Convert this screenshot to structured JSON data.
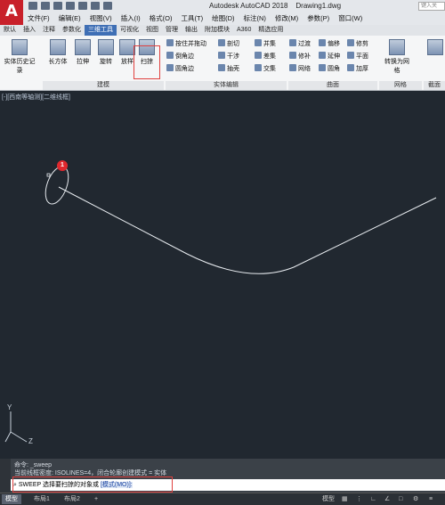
{
  "app": {
    "logo_letter": "A",
    "title": "Autodesk AutoCAD 2018",
    "file": "Drawing1.dwg",
    "search_placeholder": "键入关"
  },
  "menu": [
    "文件(F)",
    "编辑(E)",
    "视图(V)",
    "插入(I)",
    "格式(O)",
    "工具(T)",
    "绘图(D)",
    "标注(N)",
    "修改(M)",
    "参数(P)",
    "窗口(W)"
  ],
  "tabs": [
    "默认",
    "插入",
    "注释",
    "参数化",
    "三维工具",
    "可视化",
    "视图",
    "管理",
    "输出",
    "附加模块",
    "A360",
    "精选应用"
  ],
  "active_tab": "三维工具",
  "ribbon": {
    "history": "实体历史记录",
    "modeling": [
      "长方体",
      "拉伸",
      "旋转",
      "放样",
      "扫掠"
    ],
    "modeling_panel": "建模",
    "solid_edit": [
      "按住并拖动",
      "倒角边",
      "圆角边",
      "剖切",
      "干涉",
      "抽壳",
      "并集",
      "差集",
      "交集"
    ],
    "solid_edit_panel": "实体编辑",
    "surface": [
      "过渡",
      "修补",
      "网络",
      "偏移",
      "延伸",
      "圆角",
      "修剪",
      "平面",
      "加厚"
    ],
    "surface_panel": "曲面",
    "mesh_convert": "转换为网格",
    "mesh_panel": "网格",
    "section_label": "截面"
  },
  "viewport": {
    "label": "[-][西南等轴测][二维线框]",
    "badge": "1"
  },
  "ucs": {
    "y": "Y",
    "z": "Z"
  },
  "command": {
    "history_line1": "命令: _sweep",
    "history_line2": "当前线框密度: ISOLINES=4，闭合轮廓创建模式 = 实体",
    "prompt": "SWEEP 选择要扫掠的对象或",
    "option": "[模式(MO)]:"
  },
  "status": {
    "model_tab": "模型",
    "layout1": "布局1",
    "layout2": "布局2",
    "plus": "+",
    "model_label": "模型"
  }
}
